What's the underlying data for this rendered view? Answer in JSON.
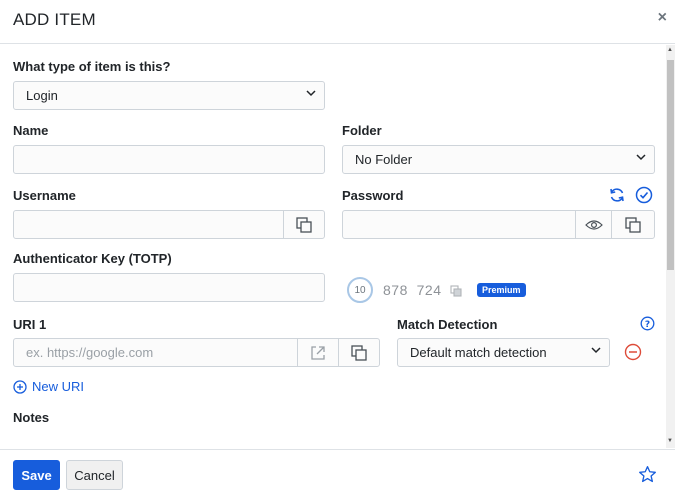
{
  "dialog": {
    "title": "ADD ITEM",
    "close_glyph": "×"
  },
  "form": {
    "type_label": "What type of item is this?",
    "type_value": "Login",
    "name_label": "Name",
    "name_value": "",
    "folder_label": "Folder",
    "folder_value": "No Folder",
    "username_label": "Username",
    "username_value": "",
    "password_label": "Password",
    "password_value": "",
    "totp_label": "Authenticator Key (TOTP)",
    "totp_value": "",
    "totp_timer": "10",
    "totp_code": "878  724",
    "premium_badge": "Premium",
    "uri_label": "URI 1",
    "uri_placeholder": "ex. https://google.com",
    "match_label": "Match Detection",
    "match_value": "Default match detection",
    "new_uri_label": "New URI",
    "notes_label": "Notes"
  },
  "footer": {
    "save_label": "Save",
    "cancel_label": "Cancel"
  },
  "icons": {
    "select_chevron": "chevron-down-icon",
    "copy": "copy-icon",
    "eye": "eye-icon",
    "refresh": "refresh-icon",
    "check": "check-circle-icon",
    "launch": "external-link-icon",
    "help": "question-circle-icon",
    "remove": "minus-circle-icon",
    "add": "plus-circle-icon",
    "star": "star-icon"
  },
  "colors": {
    "primary": "#175ddc",
    "danger": "#dd4b39",
    "border": "#ced4da",
    "text": "#212529"
  }
}
